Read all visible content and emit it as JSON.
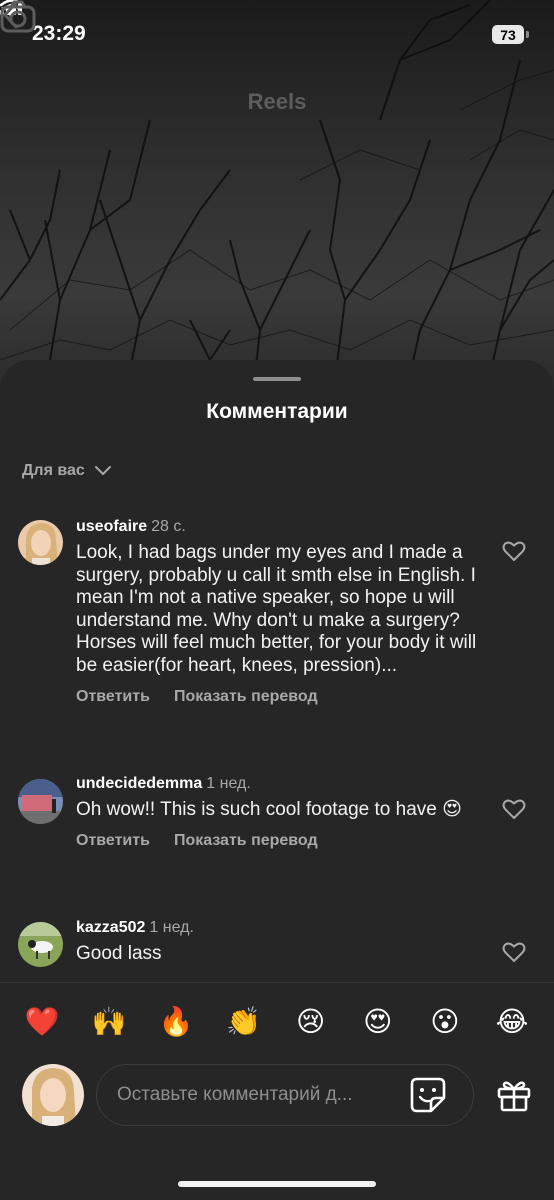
{
  "status_bar": {
    "time": "23:29",
    "battery": "73"
  },
  "nav": {
    "title": "Reels",
    "back_icon": "chevron-left-icon",
    "camera_icon": "camera-icon"
  },
  "comments_sheet": {
    "title": "Комментарии",
    "filter_label": "Для вас",
    "comments": [
      {
        "username": "useofaire",
        "time": "28 с.",
        "text": "Look, I had bags under my eyes and I made a surgery, probably u call it smth else in English. I mean I'm not a native speaker, so hope u will understand me. Why don't u make a surgery? Horses will feel much better, for your body it will be easier(for heart, knees, pression)...",
        "reply_label": "Ответить",
        "translate_label": "Показать перевод"
      },
      {
        "username": "undecidedemma",
        "time": "1 нед.",
        "text": "Oh wow!! This is such cool footage to have 😍",
        "reply_label": "Ответить",
        "translate_label": "Показать перевод"
      },
      {
        "username": "kazza502",
        "time": "1 нед.",
        "text": "Good lass"
      }
    ]
  },
  "emoji_bar": [
    "❤️",
    "🙌",
    "🔥",
    "👏",
    "😢",
    "😍",
    "😮",
    "😂"
  ],
  "input": {
    "placeholder": "Оставьте комментарий д..."
  },
  "colors": {
    "sheet_bg": "#262626",
    "secondary_text": "#a8a8a8"
  }
}
